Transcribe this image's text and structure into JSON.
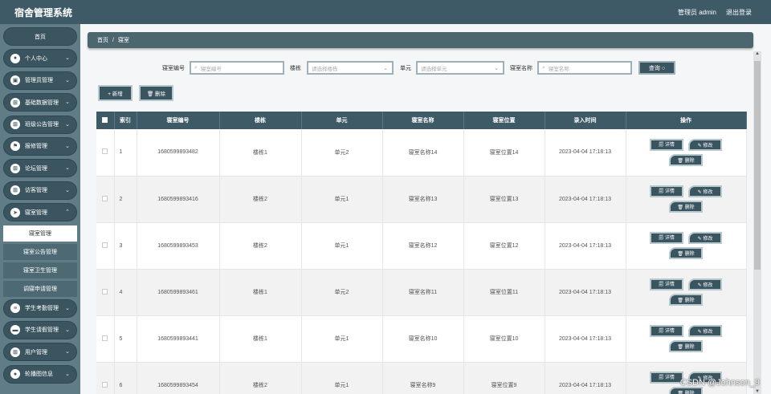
{
  "app": {
    "title": "宿舍管理系统",
    "user": "管理员 admin",
    "logout": "退出登录"
  },
  "sidebar": {
    "home": "首页",
    "items": [
      {
        "label": "个人中心",
        "icon": "user-icon"
      },
      {
        "label": "管理员管理",
        "icon": "admin-icon"
      },
      {
        "label": "基础数据管理",
        "icon": "grid-icon"
      },
      {
        "label": "班级公告管理",
        "icon": "grid-icon"
      },
      {
        "label": "报修管理",
        "icon": "flag-icon"
      },
      {
        "label": "论坛管理",
        "icon": "grid-icon"
      },
      {
        "label": "访客管理",
        "icon": "grid-icon"
      },
      {
        "label": "寝室管理",
        "icon": "send-icon"
      }
    ],
    "sub_items": [
      "寝室管理",
      "寝室公告管理",
      "寝室卫生管理",
      "调寝申请管理"
    ],
    "items_after": [
      {
        "label": "学生考勤管理",
        "icon": "list-icon"
      },
      {
        "label": "学生请假管理",
        "icon": "monitor-icon"
      },
      {
        "label": "用户管理",
        "icon": "grid-icon"
      },
      {
        "label": "轮播图信息",
        "icon": "user-icon"
      }
    ]
  },
  "breadcrumb": {
    "home": "首页",
    "separator": "/",
    "current": "寝室"
  },
  "search": {
    "room_no_label": "寝室编号",
    "room_no_placeholder": "寝室编号",
    "building_label": "楼栋",
    "building_placeholder": "请选择楼栋",
    "unit_label": "单元",
    "unit_placeholder": "请选择单元",
    "room_name_label": "寝室名称",
    "room_name_placeholder": "寝室名称",
    "query_button": "查询 ○"
  },
  "actions": {
    "add": "+ 新增",
    "delete": "🗑 删除"
  },
  "table": {
    "headers": [
      "索引",
      "寝室编号",
      "楼栋",
      "单元",
      "寝室名称",
      "寝室位置",
      "录入时间",
      "操作"
    ],
    "rows": [
      {
        "idx": "1",
        "no": "1680599893482",
        "building": "楼栋1",
        "unit": "单元2",
        "name": "寝室名称14",
        "location": "寝室位置14",
        "time": "2023-04-04 17:18:13"
      },
      {
        "idx": "2",
        "no": "1680599893416",
        "building": "楼栋2",
        "unit": "单元1",
        "name": "寝室名称13",
        "location": "寝室位置13",
        "time": "2023-04-04 17:18:13"
      },
      {
        "idx": "3",
        "no": "1680599893453",
        "building": "楼栋2",
        "unit": "单元1",
        "name": "寝室名称12",
        "location": "寝室位置12",
        "time": "2023-04-04 17:18:13"
      },
      {
        "idx": "4",
        "no": "1680599893461",
        "building": "楼栋1",
        "unit": "单元2",
        "name": "寝室名称11",
        "location": "寝室位置11",
        "time": "2023-04-04 17:18:13"
      },
      {
        "idx": "5",
        "no": "1680599893441",
        "building": "楼栋1",
        "unit": "单元1",
        "name": "寝室名称10",
        "location": "寝室位置10",
        "time": "2023-04-04 17:18:13"
      },
      {
        "idx": "6",
        "no": "1680599893454",
        "building": "楼栋2",
        "unit": "单元1",
        "name": "寝室名称9",
        "location": "寝室位置9",
        "time": "2023-04-04 17:18:13"
      }
    ],
    "op_detail": "🗐 详情",
    "op_edit": "✎ 修改",
    "op_delete": "🗑 删除"
  },
  "watermark": "CSDN @Johnson_9",
  "colors": {
    "header": "#3e5a66",
    "sidebar": "#5f7c87",
    "button": "#3b5560"
  }
}
